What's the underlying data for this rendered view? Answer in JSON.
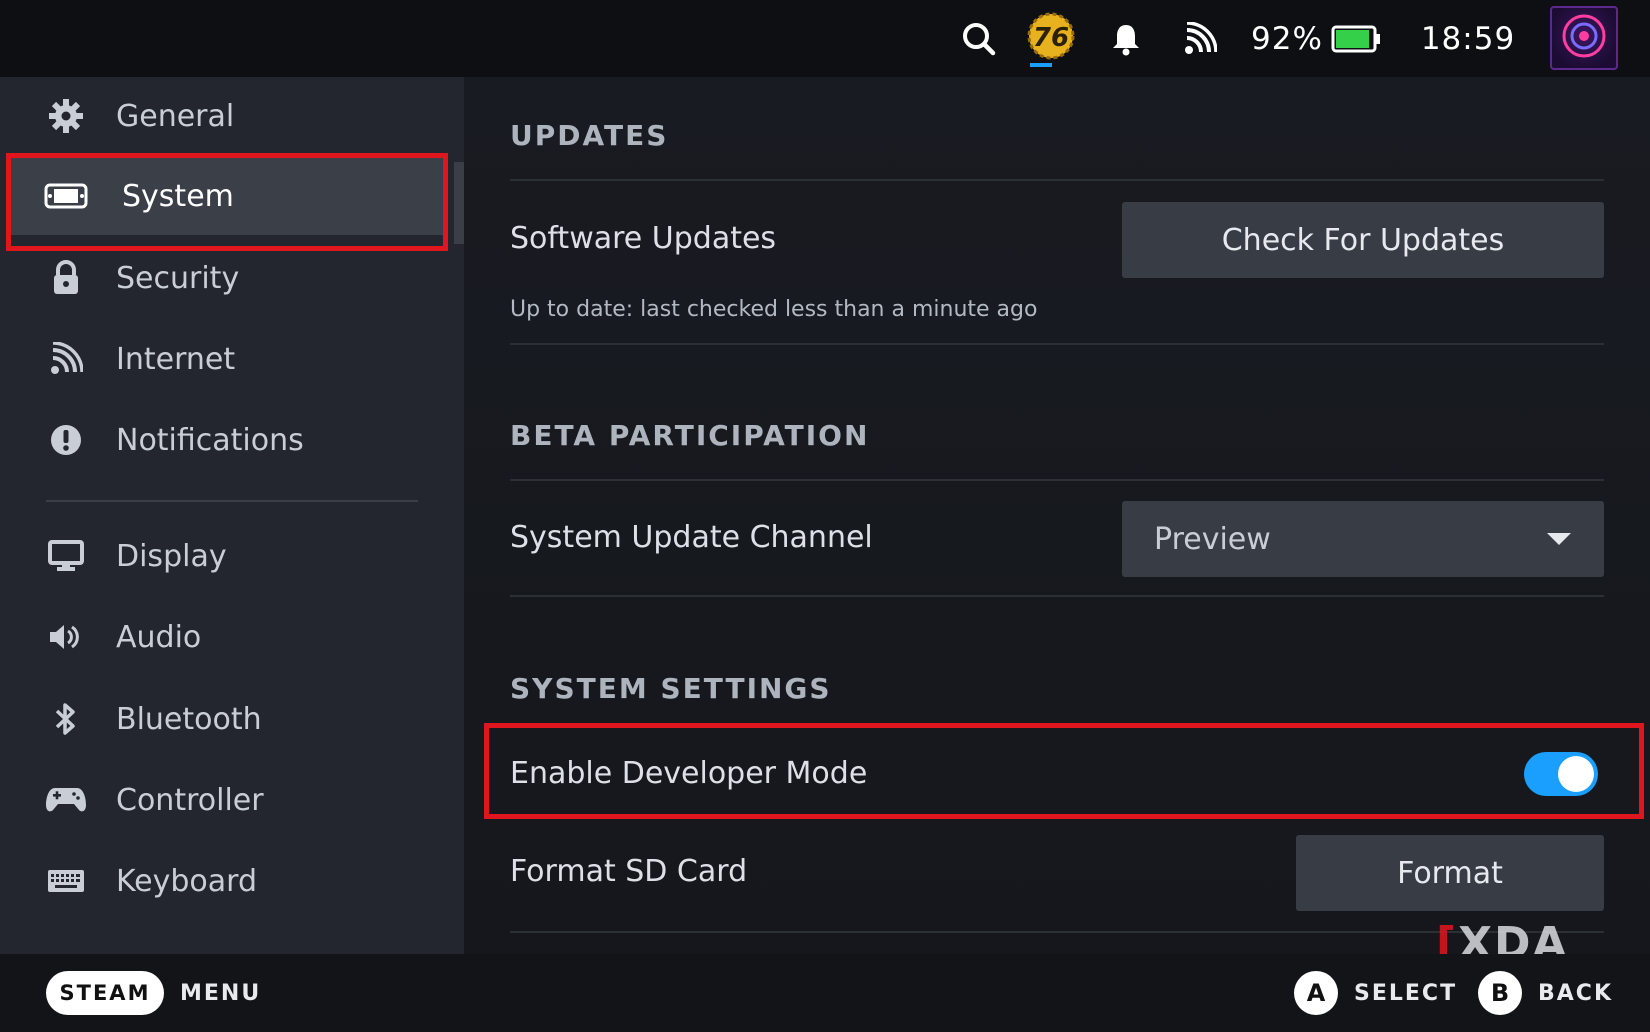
{
  "status_bar": {
    "search_icon": "search-icon",
    "game_badge": "76",
    "bell_icon": "bell-icon",
    "wifi_icon": "wifi-icon",
    "battery_percent": "92%",
    "battery_level": 0.92,
    "time": "18:59",
    "accent_battery": "#35d04a"
  },
  "sidebar": {
    "items": [
      {
        "label": "General",
        "icon": "gear-icon"
      },
      {
        "label": "System",
        "icon": "system-icon",
        "active": true
      },
      {
        "label": "Security",
        "icon": "lock-icon"
      },
      {
        "label": "Internet",
        "icon": "wifi-icon"
      },
      {
        "label": "Notifications",
        "icon": "alert-icon"
      },
      {
        "label": "Display",
        "icon": "monitor-icon"
      },
      {
        "label": "Audio",
        "icon": "speaker-icon"
      },
      {
        "label": "Bluetooth",
        "icon": "bluetooth-icon"
      },
      {
        "label": "Controller",
        "icon": "gamepad-icon"
      },
      {
        "label": "Keyboard",
        "icon": "keyboard-icon"
      }
    ]
  },
  "main": {
    "updates": {
      "heading": "UPDATES",
      "software_updates_label": "Software Updates",
      "check_button": "Check For Updates",
      "status": "Up to date: last checked less than a minute ago"
    },
    "beta": {
      "heading": "BETA PARTICIPATION",
      "channel_label": "System Update Channel",
      "channel_value": "Preview"
    },
    "system_settings": {
      "heading": "SYSTEM SETTINGS",
      "dev_mode_label": "Enable Developer Mode",
      "dev_mode_enabled": true,
      "format_label": "Format SD Card",
      "format_button": "Format"
    },
    "watermark": "XDA"
  },
  "bottom_bar": {
    "steam_label": "STEAM",
    "menu_label": "MENU",
    "a_button": "A",
    "select_label": "SELECT",
    "b_button": "B",
    "back_label": "BACK"
  },
  "colors": {
    "highlight": "#e0161f",
    "toggle_on": "#1a9fff"
  }
}
